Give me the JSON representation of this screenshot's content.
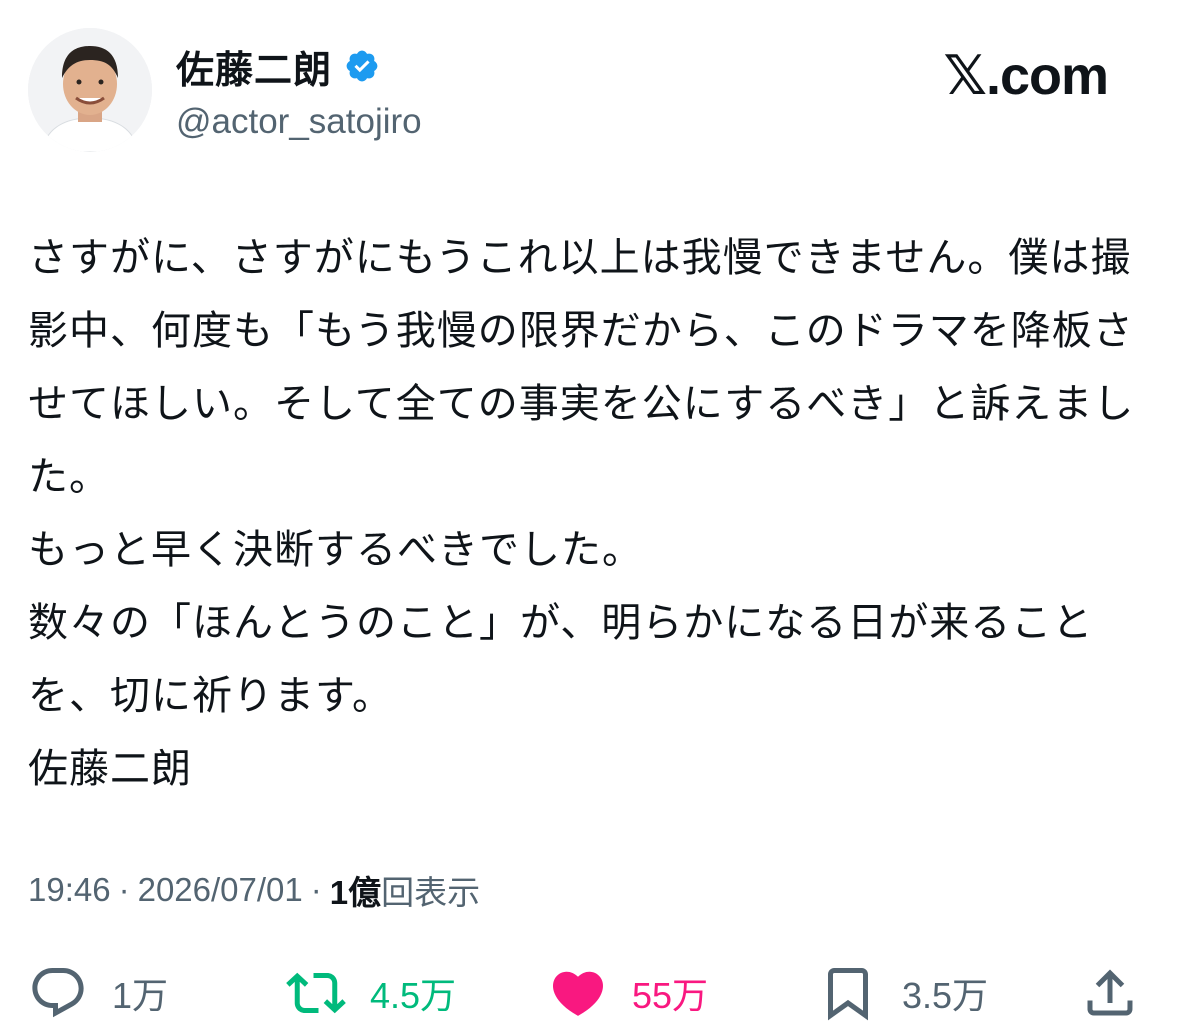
{
  "user": {
    "display_name": "佐藤二朗",
    "handle": "@actor_satojiro",
    "verified_icon": "verified-badge-icon",
    "avatar_icon": "profile-avatar"
  },
  "brand": {
    "logo_text": "𝕏.com"
  },
  "tweet": {
    "text": "さすがに、さすがにもうこれ以上は我慢できません。僕は撮影中、何度も「もう我慢の限界だから、このドラマを降板させてほしい。そして全ての事実を公にするべき」と訴えました。\nもっと早く決断するべきでした。\n数々の「ほんとうのこと」が、明らかになる日が来ることを、切に祈ります。\n佐藤二朗"
  },
  "meta": {
    "time": "19:46",
    "separator": "·",
    "date": "2026/07/01",
    "views_count": "1億",
    "views_label": "回表示"
  },
  "actions": {
    "reply": {
      "icon": "reply-icon",
      "count": "1万"
    },
    "repost": {
      "icon": "repost-icon",
      "count": "4.5万"
    },
    "like": {
      "icon": "heart-icon",
      "count": "55万"
    },
    "bookmark": {
      "icon": "bookmark-icon",
      "count": "3.5万"
    },
    "share": {
      "icon": "share-icon"
    }
  },
  "colors": {
    "text": "#0f1419",
    "secondary": "#536471",
    "verified": "#1d9bf0",
    "repost": "#00ba7c",
    "like": "#f91880"
  }
}
